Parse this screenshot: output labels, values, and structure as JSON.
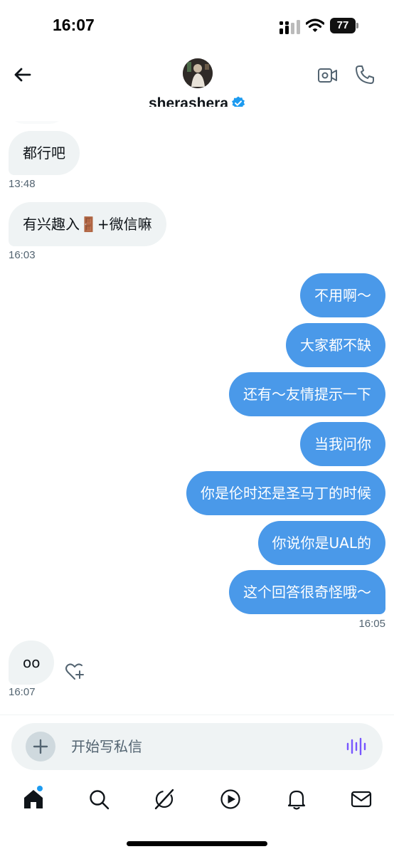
{
  "status_bar": {
    "time": "16:07",
    "battery": "77"
  },
  "header": {
    "name": "sherashera",
    "verified": true,
    "icons": [
      "back-arrow-icon",
      "video-camera-icon",
      "phone-icon",
      "verified-badge-icon"
    ]
  },
  "messages": [
    {
      "side": "in",
      "text": "都行吧"
    },
    {
      "side": "in",
      "text": "有兴趣入🚪+微信嘛"
    },
    {
      "side": "out",
      "text": "不用啊～"
    },
    {
      "side": "out",
      "text": "大家都不缺"
    },
    {
      "side": "out",
      "text": "还有～友情提示一下"
    },
    {
      "side": "out",
      "text": "当我问你"
    },
    {
      "side": "out",
      "text": "你是伦时还是圣马丁的时候"
    },
    {
      "side": "out",
      "text": "你说你是UAL的"
    },
    {
      "side": "out",
      "text": "这个回答很奇怪哦～"
    },
    {
      "side": "in",
      "text": "oo"
    }
  ],
  "timestamps": [
    "13:48",
    "16:03",
    "16:05",
    "16:07"
  ],
  "composer": {
    "placeholder": "开始写私信"
  },
  "tabs": [
    "home-icon",
    "search-icon",
    "grok-icon",
    "video-play-icon",
    "notifications-bell-icon",
    "messages-envelope-icon"
  ],
  "colors": {
    "accent": "#1d9bf0",
    "outgoing_bubble": "#4a99e9",
    "incoming_bubble": "#eff3f4",
    "voice_icon": "#7856ff"
  }
}
